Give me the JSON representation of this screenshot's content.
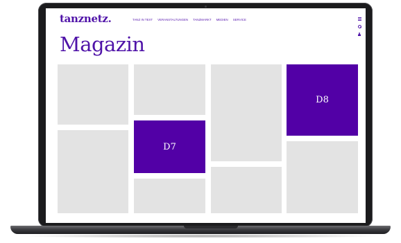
{
  "header": {
    "logo": "tanznetz.",
    "nav": [
      "TANZ IN TEXT",
      "VERANSTALTUNGEN",
      "TANZMARKT",
      "MEDIEN",
      "SERVICE"
    ],
    "icons": [
      "menu-icon",
      "search-icon",
      "user-icon"
    ]
  },
  "main": {
    "title": "Magazin",
    "tiles": {
      "d7_label": "D7",
      "d8_label": "D8"
    }
  },
  "colors": {
    "brand": "#4f13a8",
    "accent_tile": "#5200a6",
    "placeholder_tile": "#e3e3e3",
    "device_frame": "#1b1b1d"
  }
}
